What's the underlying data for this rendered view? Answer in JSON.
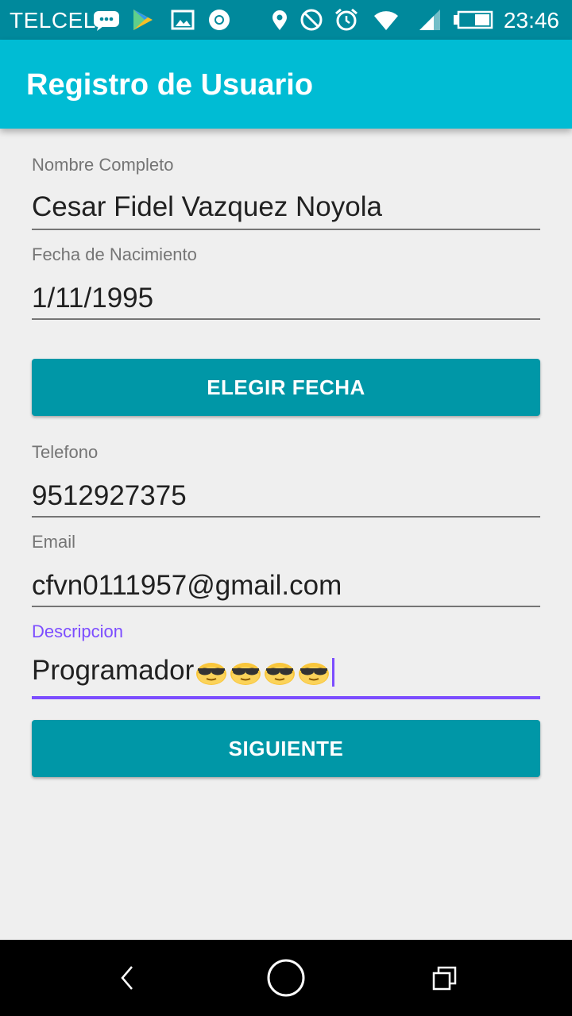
{
  "status_bar": {
    "carrier": "TELCEL",
    "time": "23:46",
    "icons": [
      "message-icon",
      "play-store-icon",
      "gallery-icon",
      "chrome-icon",
      "location-icon",
      "do-not-disturb-icon",
      "alarm-icon",
      "wifi-icon",
      "signal-icon",
      "battery-icon"
    ]
  },
  "app_bar": {
    "title": "Registro de Usuario"
  },
  "form": {
    "name_label": "Nombre Completo",
    "name_value": "Cesar Fidel Vazquez Noyola",
    "birth_label": "Fecha de Nacimiento",
    "birth_value": "1/11/1995",
    "pick_date_button": "ELEGIR FECHA",
    "phone_label": "Telefono",
    "phone_value": "9512927375",
    "email_label": "Email",
    "email_value": "cfvn0111957@gmail.com",
    "description_label": "Descripcion",
    "description_value": "Programador",
    "description_emoji": "sunglasses-face-emoji",
    "description_emoji_count": 4,
    "next_button": "SIGUIENTE"
  },
  "colors": {
    "status_bar": "#00899c",
    "app_bar": "#00bcd4",
    "button": "#0097a7",
    "accent": "#7c4dff",
    "background": "#efefef"
  },
  "nav_bar": {
    "icons": [
      "back-icon",
      "home-icon",
      "recents-icon"
    ]
  }
}
